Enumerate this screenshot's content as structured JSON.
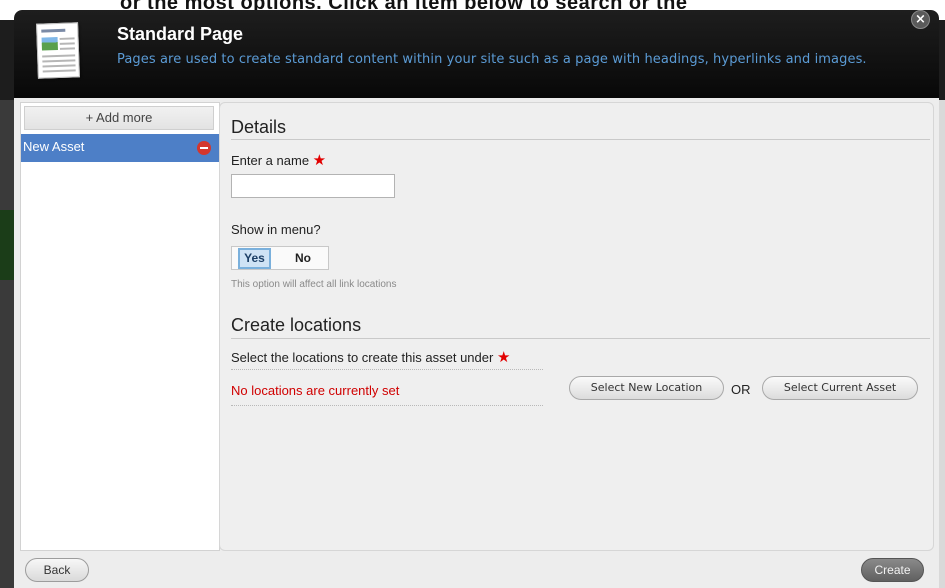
{
  "backdrop": {
    "strip_text": "or the most options. Click an item below to search or the"
  },
  "modal": {
    "title": "Standard Page",
    "subtitle": "Pages are used to create standard content within your site such as a page with headings, hyperlinks and images.",
    "close_glyph": "×",
    "icon_caption": "Standard Page"
  },
  "left_panel": {
    "add_more_label": "+ Add more",
    "assets": [
      {
        "label": "New Asset",
        "selected": true
      }
    ]
  },
  "details": {
    "heading": "Details",
    "name_label": "Enter a name",
    "name_value": "",
    "required_mark": "★",
    "menu_label": "Show in menu?",
    "toggle": {
      "yes_label": "Yes",
      "no_label": "No",
      "selected": "Yes"
    },
    "hint": "This option will affect all link locations"
  },
  "locations": {
    "heading": "Create locations",
    "select_label": "Select the locations to create this asset under",
    "required_mark": "★",
    "empty_message": "No locations are currently set",
    "select_new_label": "Select New Location",
    "or_label": "OR",
    "select_current_label": "Select Current Asset"
  },
  "footer": {
    "back_label": "Back",
    "create_label": "Create"
  },
  "colors": {
    "header_bg": "#111111",
    "subtitle": "#5b9bd5",
    "selected_item": "#4d7fc7",
    "required_star": "#e20000",
    "error_text": "#d00000"
  }
}
